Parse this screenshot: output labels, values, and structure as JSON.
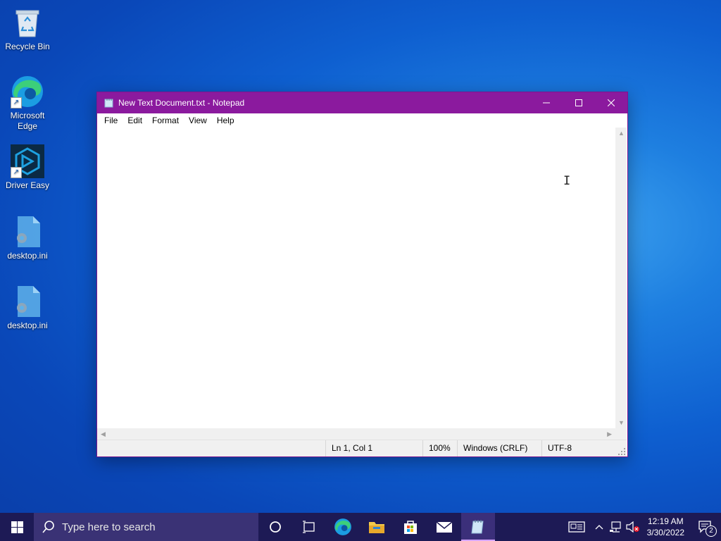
{
  "desktop": {
    "icons": [
      {
        "label": "Recycle Bin"
      },
      {
        "label": "Microsoft Edge"
      },
      {
        "label": "Driver Easy"
      },
      {
        "label": "desktop.ini"
      },
      {
        "label": "desktop.ini"
      }
    ]
  },
  "window": {
    "title": "New Text Document.txt - Notepad",
    "accent_color": "#8b1a9e",
    "menu": [
      "File",
      "Edit",
      "Format",
      "View",
      "Help"
    ],
    "content": "",
    "status": {
      "position": "Ln 1, Col 1",
      "zoom": "100%",
      "line_ending": "Windows (CRLF)",
      "encoding": "UTF-8"
    }
  },
  "taskbar": {
    "search_placeholder": "Type here to search",
    "pinned": [
      "cortana-icon",
      "task-view-icon",
      "edge-icon",
      "file-explorer-icon",
      "store-icon",
      "mail-icon",
      "notepad-icon"
    ],
    "clock": {
      "time": "12:19 AM",
      "date": "3/30/2022"
    },
    "notification_count": "2"
  }
}
